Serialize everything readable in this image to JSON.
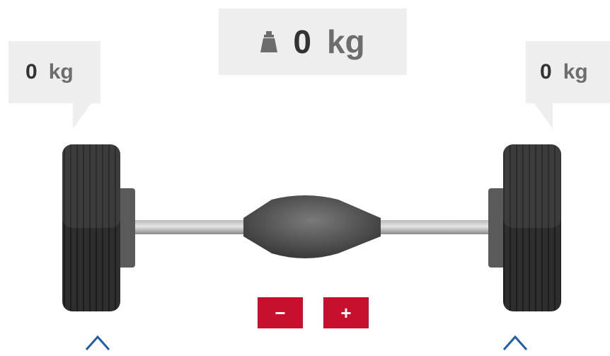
{
  "total": {
    "icon": "weight-icon",
    "value": "0",
    "unit": "kg"
  },
  "left_wheel": {
    "value": "0",
    "unit": "kg"
  },
  "right_wheel": {
    "value": "0",
    "unit": "kg"
  },
  "controls": {
    "decrease_label": "−",
    "increase_label": "+"
  },
  "selectors": {
    "left_icon": "chevron-up-icon",
    "right_icon": "chevron-up-icon"
  },
  "colors": {
    "accent": "#c8102e",
    "chevron": "#1f5fa8",
    "panel": "#eeeeee",
    "value_text": "#333333",
    "unit_text": "#6d6d6d"
  }
}
